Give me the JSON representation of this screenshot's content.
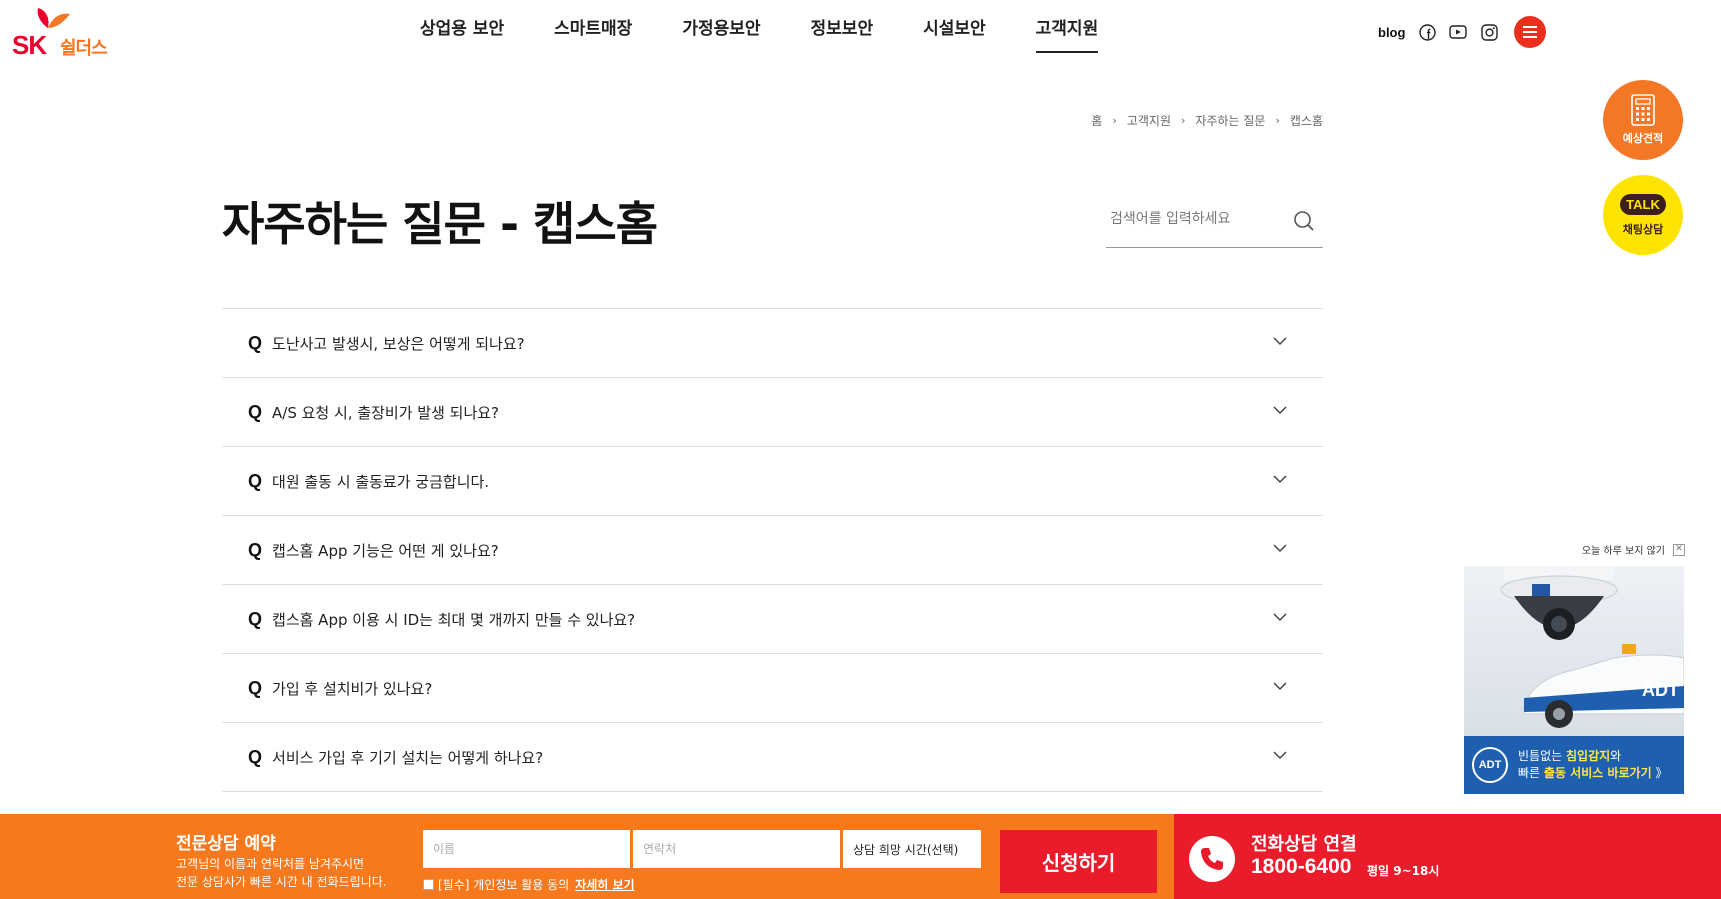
{
  "header": {
    "logo": {
      "sk": "SK",
      "name": "쉴더스"
    },
    "nav": [
      "상업용 보안",
      "스마트매장",
      "가정용보안",
      "정보보안",
      "시설보안",
      "고객지원"
    ],
    "active_nav_index": 5,
    "utils": {
      "blog": "blog",
      "icons": [
        "facebook-icon",
        "youtube-icon",
        "instagram-icon",
        "menu-icon"
      ]
    }
  },
  "floating": {
    "estimate_label": "예상견적",
    "chat_badge": "TALK",
    "chat_label": "채팅상담"
  },
  "breadcrumb": [
    "홈",
    "고객지원",
    "자주하는 질문",
    "캡스홈"
  ],
  "page_title": "자주하는 질문 - 캡스홈",
  "search": {
    "placeholder": "검색어를 입력하세요"
  },
  "faq": {
    "q_marker": "Q",
    "items": [
      "도난사고 발생시, 보상은 어떻게 되나요?",
      "A/S 요청 시, 출장비가 발생 되나요?",
      "대원 출동 시 출동료가 궁금합니다.",
      "캡스홈 App 기능은 어떤 게 있나요?",
      "캡스홈 App 이용 시 ID는 최대 몇 개까지 만들 수 있나요?",
      "가입 후 설치비가 있나요?",
      "서비스 가입 후 기기 설치는 어떻게 하나요?"
    ]
  },
  "popup": {
    "close_today": "오늘 하루 보지 않기",
    "adt": "ADT",
    "line1_pre": "빈틈없는 ",
    "line1_bold": "침입감지",
    "line1_post": "와",
    "line2_pre": "빠른 ",
    "line2_bold": "출동 서비스 바로가기",
    "line2_post": " 》"
  },
  "consult": {
    "title": "전문상담 예약",
    "desc_line1": "고객님의 이름과 연락처를 남겨주시면",
    "desc_line2": "전문 상담사가 빠른 시간 내 전화드립니다.",
    "name_placeholder": "이름",
    "phone_placeholder": "연락처",
    "time_select": "상담 희망 시간(선택)",
    "agree_text": "[필수] 개인정보 활용 동의",
    "agree_more": "자세히 보기",
    "submit": "신청하기"
  },
  "call": {
    "title": "전화상담 연결",
    "number": "1800-6400",
    "hours": "평일 9~18시"
  },
  "colors": {
    "orange": "#f7791e",
    "red": "#ea1c2b",
    "kakao": "#fde400"
  }
}
